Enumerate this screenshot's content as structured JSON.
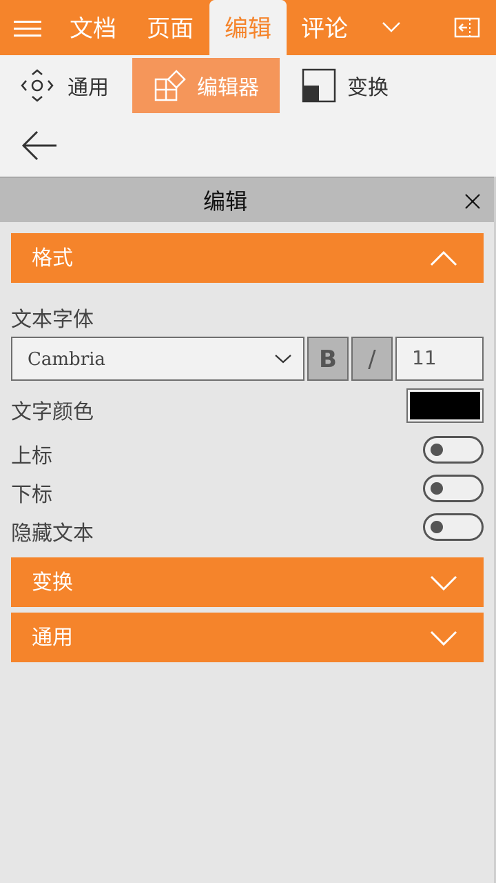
{
  "topbar": {
    "tabs": [
      {
        "label": "文档"
      },
      {
        "label": "页面"
      },
      {
        "label": "编辑"
      },
      {
        "label": "评论"
      }
    ],
    "active_tab": "编辑"
  },
  "ribbon": {
    "items": [
      {
        "label": "通用",
        "icon": "move-icon"
      },
      {
        "label": "编辑器",
        "icon": "editor-shapes-icon"
      },
      {
        "label": "变换",
        "icon": "transform-icon"
      }
    ],
    "active_item": "编辑器"
  },
  "panel": {
    "title": "编辑"
  },
  "sections": {
    "format": {
      "label": "格式",
      "expanded": true
    },
    "transform": {
      "label": "变换",
      "expanded": false
    },
    "general": {
      "label": "通用",
      "expanded": false
    }
  },
  "format": {
    "font_label": "文本字体",
    "font_value": "Cambria",
    "bold_label": "B",
    "italic_label": "/",
    "font_size": "11",
    "color_label": "文字颜色",
    "color_value": "#000000",
    "superscript_label": "上标",
    "superscript_on": false,
    "subscript_label": "下标",
    "subscript_on": false,
    "hidden_text_label": "隐藏文本",
    "hidden_text_on": false
  },
  "colors": {
    "accent": "#f5842b",
    "ribbon_active": "#f5965a",
    "panel_header": "#bababa",
    "background": "#e6e6e6"
  }
}
